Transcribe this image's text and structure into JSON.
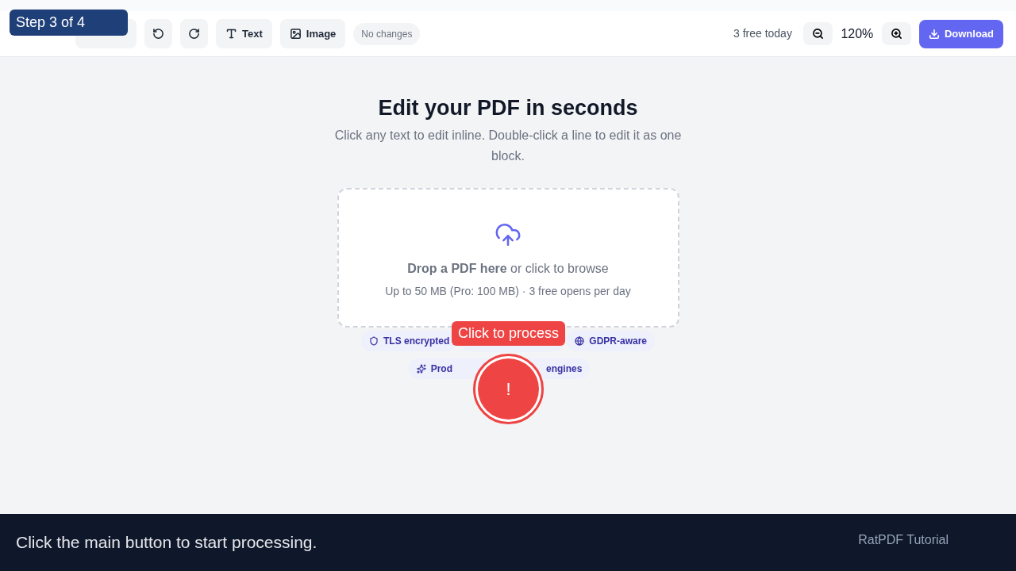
{
  "toolbar": {
    "buttons": [
      {
        "kind": "open"
      },
      {
        "kind": "undo"
      },
      {
        "kind": "redo"
      },
      {
        "kind": "text",
        "label": "Text"
      },
      {
        "kind": "image",
        "label": "Image"
      }
    ],
    "status": "No changes",
    "quota": "3 free today",
    "zoom": "120%",
    "download": "Download"
  },
  "hero": {
    "title": "Edit your PDF in seconds",
    "subtitle": "Click any text to edit inline. Double-click a line to edit it as one block."
  },
  "dropzone": {
    "prompt": "**Drop a PDF here** or click to browse",
    "limits": "Up to 50 MB (Pro: 100 MB) · 3 free opens per day"
  },
  "badges": [
    {
      "kind": "shield",
      "label": "TLS encrypted"
    },
    {
      "kind": "hidden"
    },
    {
      "kind": "globe",
      "label": "GDPR-aware"
    },
    {
      "kind": "sparkle",
      "label": "Prod",
      "label_end": "engines"
    }
  ],
  "tutorial": {
    "step": "Step 3 of 4",
    "tooltip": "Click to process",
    "marker": "!",
    "caption": "Click the main button to start processing.",
    "brand": "RatPDF Tutorial"
  }
}
